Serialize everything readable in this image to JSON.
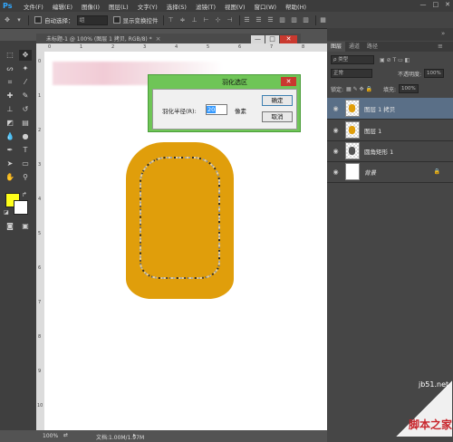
{
  "app": {
    "logo": "Ps"
  },
  "menubar": {
    "items": [
      "文件(F)",
      "编辑(E)",
      "图像(I)",
      "图层(L)",
      "文字(Y)",
      "选择(S)",
      "滤镜(T)",
      "视图(V)",
      "窗口(W)",
      "帮助(H)"
    ],
    "window_controls": [
      "—",
      "□",
      "✕"
    ]
  },
  "options": {
    "auto_select_label": "自动选择：",
    "auto_select_value": "组",
    "show_transform_label": "显示变换控件"
  },
  "document": {
    "tab_title": "未标题-1 @ 100% (图层 1 拷贝, RGB/8) *",
    "close_glyph": "×",
    "window_buttons": [
      "—",
      "□",
      "✕"
    ],
    "ruler_top_numbers": [
      "0",
      "1",
      "2",
      "3",
      "4",
      "5",
      "6",
      "7",
      "8"
    ],
    "ruler_left_numbers": [
      "0",
      "1",
      "2",
      "3",
      "4",
      "5",
      "6",
      "7",
      "8",
      "9",
      "10"
    ]
  },
  "dialog": {
    "title": "羽化选区",
    "close_glyph": "✕",
    "radius_label": "羽化半径(R):",
    "radius_value": "20",
    "unit": "像素",
    "ok_label": "确定",
    "cancel_label": "取消"
  },
  "layers_panel": {
    "tabs": [
      "图层",
      "通道",
      "路径"
    ],
    "filter_kind": "ρ 类型",
    "blend_mode": "正常",
    "opacity_label": "不透明度:",
    "opacity_value": "100%",
    "lock_label": "锁定:",
    "fill_label": "填充:",
    "fill_value": "100%",
    "layers": [
      {
        "name": "图层 1 拷贝",
        "selected": true
      },
      {
        "name": "图层 1",
        "selected": false
      },
      {
        "name": "圆角矩形 1",
        "selected": false
      },
      {
        "name": "背景",
        "selected": false
      }
    ]
  },
  "statusbar": {
    "zoom": "100%",
    "doc_info": "文档:1.00M/1.97M"
  },
  "watermark": {
    "site": "jb51.net",
    "brand": "脚本之家"
  },
  "colors": {
    "shape_fill": "#e09e0b",
    "foreground": "#ffff1a",
    "background": "#ffffff",
    "dialog_titlebar": "#6fc557",
    "selected_layer": "#5a6f87"
  }
}
